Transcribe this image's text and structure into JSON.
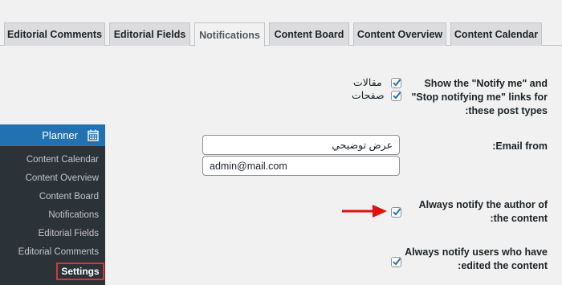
{
  "tabs": [
    {
      "label": "Editorial Comments",
      "active": false
    },
    {
      "label": "Editorial Fields",
      "active": false
    },
    {
      "label": "Notifications",
      "active": true
    },
    {
      "label": "Content Board",
      "active": false
    },
    {
      "label": "Content Overview",
      "active": false
    },
    {
      "label": "Content Calendar",
      "active": false
    }
  ],
  "sidebar": {
    "header": "Planner",
    "header_icon": "calendar-icon",
    "items": [
      {
        "label": "Content Calendar"
      },
      {
        "label": "Content Overview"
      },
      {
        "label": "Content Board"
      },
      {
        "label": "Notifications"
      },
      {
        "label": "Editorial Fields"
      },
      {
        "label": "Editorial Comments"
      }
    ],
    "active_item": "Settings",
    "highlight_color": "#d63638"
  },
  "settings": {
    "post_types": {
      "label": "Show the \"Notify me\" and \"Stop notifying me\" links for these post types:",
      "options": [
        {
          "label": "مقالات",
          "checked": true
        },
        {
          "label": "صفحات",
          "checked": true
        }
      ]
    },
    "email_from": {
      "label": "Email from:",
      "name_value": "عرض توضيحي",
      "email_value": "admin@mail.com"
    },
    "notify_author": {
      "label": "Always notify the author of the content:",
      "checked": true
    },
    "notify_editors": {
      "label": "Always notify users who have edited the content:",
      "checked": true
    }
  },
  "colors": {
    "accent": "#2271b1",
    "sidebar_bg": "#2c3338",
    "arrow": "#e01010"
  }
}
